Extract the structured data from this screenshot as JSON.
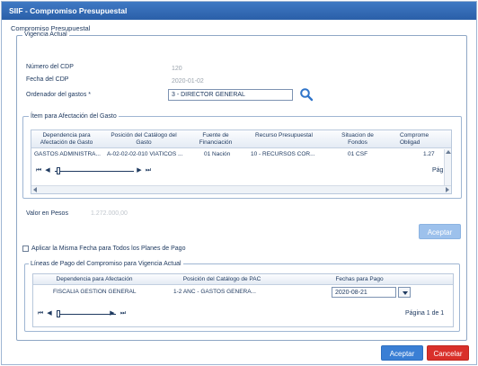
{
  "window": {
    "title": "SIIF - Compromiso Presupuestal"
  },
  "subtitle": "Compromiso Presupuestal",
  "vigencia": {
    "legend": "Vigencia Actual",
    "numero_cdp_label": "Número del CDP",
    "numero_cdp_value": "120",
    "fecha_cdp_label": "Fecha del CDP",
    "fecha_cdp_value": "2020-01-02",
    "ordenador_label": "Ordenador del gastos *",
    "ordenador_value": "3 - DIRECTOR GENERAL"
  },
  "items": {
    "legend": "Ítem para Afectación del Gasto",
    "columns": [
      "Dependencia para Afectación de Gasto",
      "Posición del Catálogo del Gasto",
      "Fuente de Financiación",
      "Recurso Presupuestal",
      "Situacion de Fondos",
      "Comprome Obligad"
    ],
    "rows": [
      [
        "GASTOS ADMINISTRA...",
        "A-02-02-02-010 VIATICOS ...",
        "01 Nación",
        "10 - RECURSOS COR...",
        "01 CSF",
        "1.27"
      ]
    ],
    "pager_text": "Pág"
  },
  "valor": {
    "label": "Valor en Pesos",
    "value": "1.272.000,00"
  },
  "aceptar_items": "Aceptar",
  "misma_fecha_label": "Aplicar la Misma Fecha para Todos los Planes de Pago",
  "lineas": {
    "legend": "Líneas de Pago del Compromiso para Vigencia Actual",
    "columns": [
      "Dependencia para Afectación",
      "Posición del Catálogo de PAC",
      "Fechas para Pago"
    ],
    "rows": [
      [
        "FISCALIA GESTION GENERAL",
        "1-2 ANC - GASTOS GENERA...",
        "2020-08-21"
      ]
    ],
    "pager_text": "Página 1 de 1"
  },
  "footer": {
    "aceptar": "Aceptar",
    "cancelar": "Cancelar"
  },
  "colors": {
    "titlebar": "#2f66b0",
    "accept_enabled": "#3a7fd5",
    "accept_disabled": "#9dc1ec",
    "cancel": "#d9302a"
  },
  "icons": [
    "search-icon",
    "first-page-icon",
    "prev-page-icon",
    "next-page-icon",
    "last-page-icon",
    "chevron-down-icon"
  ]
}
